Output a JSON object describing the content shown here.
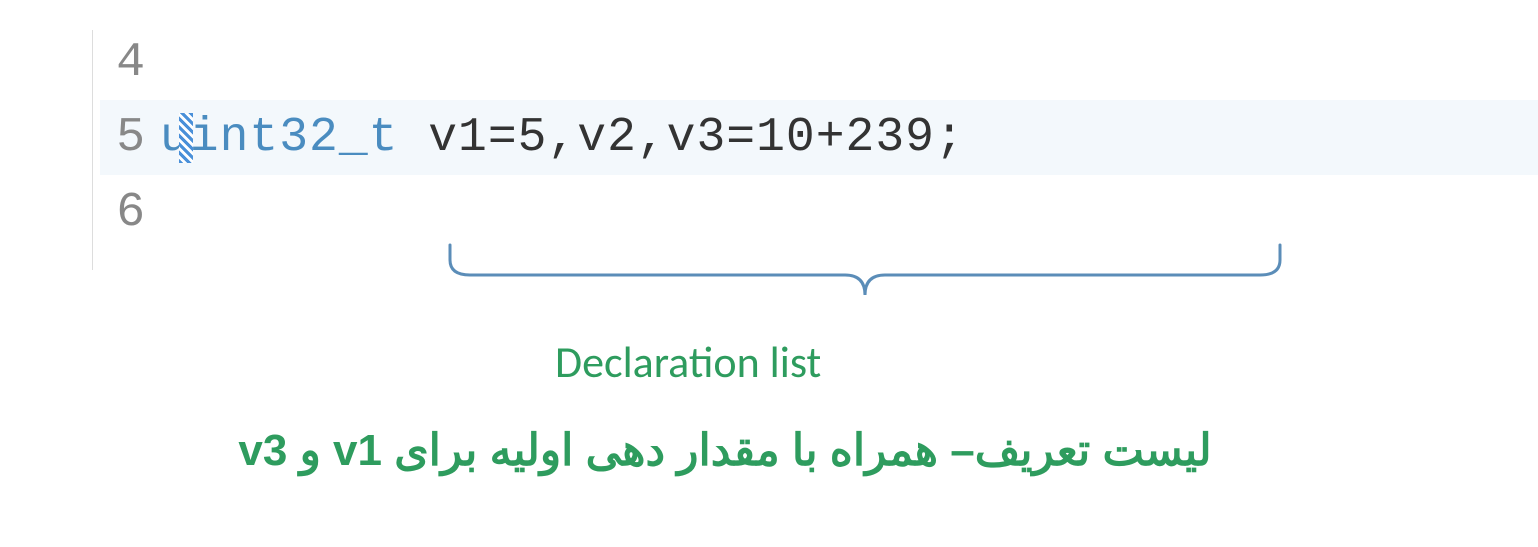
{
  "code": {
    "lines": [
      {
        "number": "4",
        "content": ""
      },
      {
        "number": "5",
        "keyword": "uint32_t",
        "rest": " v1=5,v2,v3=10+239;"
      },
      {
        "number": "6",
        "content": ""
      }
    ]
  },
  "annotations": {
    "english": "Declaration list",
    "farsi": "لیست تعریف– همراه با مقدار دهی اولیه برای v1 و v3"
  }
}
